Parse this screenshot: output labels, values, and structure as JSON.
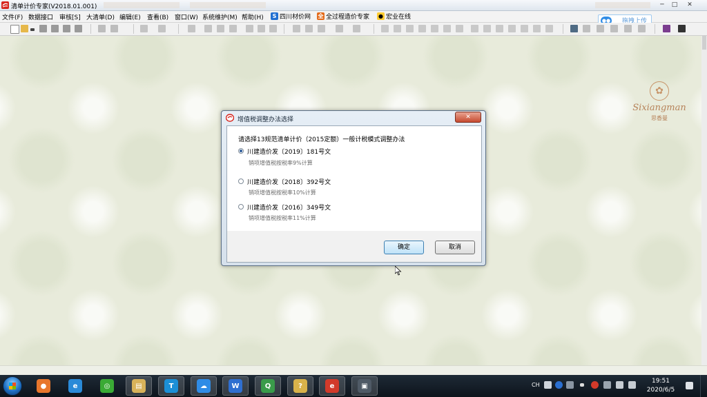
{
  "window": {
    "title": "清单计价专家(V2018.01.001)",
    "controls": {
      "min": "─",
      "max": "□",
      "close": "✕"
    }
  },
  "menu": {
    "items": [
      "文件(F)",
      "数据接口",
      "审核[S]",
      "大清单(D)",
      "编辑(E)",
      "查看(B)",
      "窗口(W)",
      "系统维护(M)",
      "帮助(H)"
    ],
    "links": [
      {
        "label": "四川材价网",
        "icon": "s-logo-icon",
        "color": "#1f6ed1",
        "glyph": "S"
      },
      {
        "label": "全过程造价专家",
        "icon": "orange-app-icon",
        "color": "#e46b1b",
        "glyph": "全"
      },
      {
        "label": "宏业在线",
        "icon": "qq-penguin-icon",
        "color": "#333333",
        "glyph": "●"
      }
    ]
  },
  "upload": {
    "label": "拖拽上传"
  },
  "logo": {
    "word": "Sixiangman",
    "sub": "思香曼"
  },
  "dialog": {
    "title": "增值税调整办法选择",
    "close_glyph": "✕",
    "prompt": "请选择13规范清单计价（2015定额）一般计税模式调整办法",
    "options": [
      {
        "label": "川建造价发〔2019〕181号文",
        "desc": "销项增值税按税率9%计算",
        "checked": true
      },
      {
        "label": "川建造价发〔2018〕392号文",
        "desc": "销项增值税按税率10%计算",
        "checked": false
      },
      {
        "label": "川建造价发〔2016〕349号文",
        "desc": "销项增值税按税率11%计算",
        "checked": false
      }
    ],
    "ok": "确定",
    "cancel": "取消"
  },
  "taskbar": {
    "apps": [
      {
        "name": "ppt-color-app-icon",
        "color": "#e8762c",
        "glyph": "●"
      },
      {
        "name": "ie-browser-icon",
        "color": "#2a8ad8",
        "glyph": "e"
      },
      {
        "name": "green-browser-icon",
        "color": "#3aaa35",
        "glyph": "◎"
      },
      {
        "name": "file-explorer-icon",
        "color": "#d8b25a",
        "glyph": "▤"
      },
      {
        "name": "text-app-icon",
        "color": "#1c8fd6",
        "glyph": "T"
      },
      {
        "name": "cloud-drive-icon",
        "color": "#2f8ce6",
        "glyph": "☁"
      },
      {
        "name": "wps-writer-icon",
        "color": "#2f6fd0",
        "glyph": "W"
      },
      {
        "name": "spreadsheet-app-icon",
        "color": "#3a9b4a",
        "glyph": "Q"
      },
      {
        "name": "help-app-icon",
        "color": "#d9b24a",
        "glyph": "?"
      },
      {
        "name": "price-expert-app-icon",
        "color": "#d23a2a",
        "glyph": "e"
      },
      {
        "name": "camera-app-icon",
        "color": "#4f5a66",
        "glyph": "▣"
      }
    ],
    "lang": "CH",
    "time": "19:51",
    "date": "2020/6/5"
  }
}
